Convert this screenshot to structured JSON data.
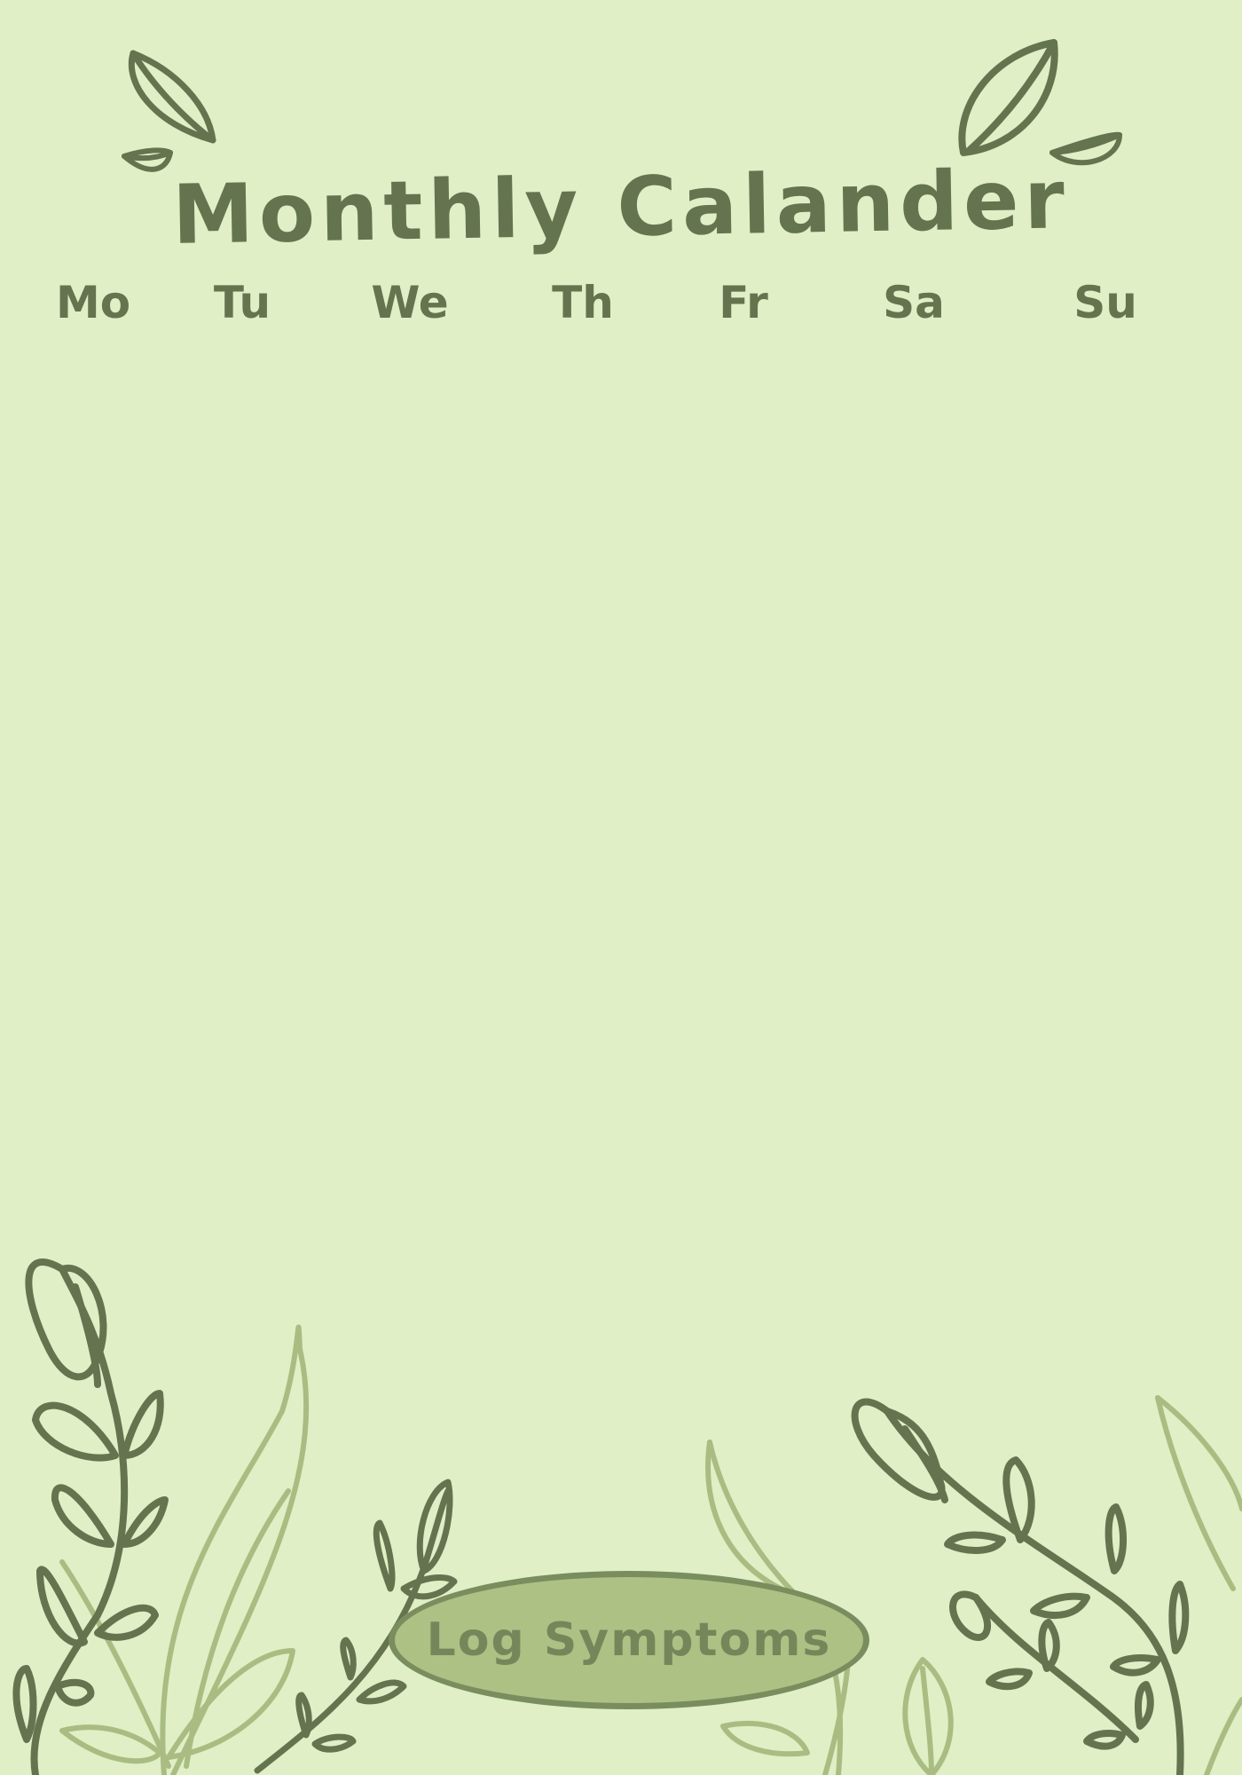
{
  "header": {
    "title": "Monthly Calander"
  },
  "weekdays": [
    "Mo",
    "Tu",
    "We",
    "Th",
    "Fr",
    "Sa",
    "Su"
  ],
  "actions": {
    "log_symptoms_label": "Log Symptoms"
  },
  "colors": {
    "background": "#e0efc5",
    "ink_dark": "#64744f",
    "ink_light": "#a9bd82",
    "button_fill": "#adc184",
    "button_border": "#7a8d5e"
  },
  "icons": {
    "top_left": "leaf-icon",
    "top_right": "leaf-icon",
    "bottom_left": "vine-icon",
    "bottom_right": "vine-icon"
  }
}
